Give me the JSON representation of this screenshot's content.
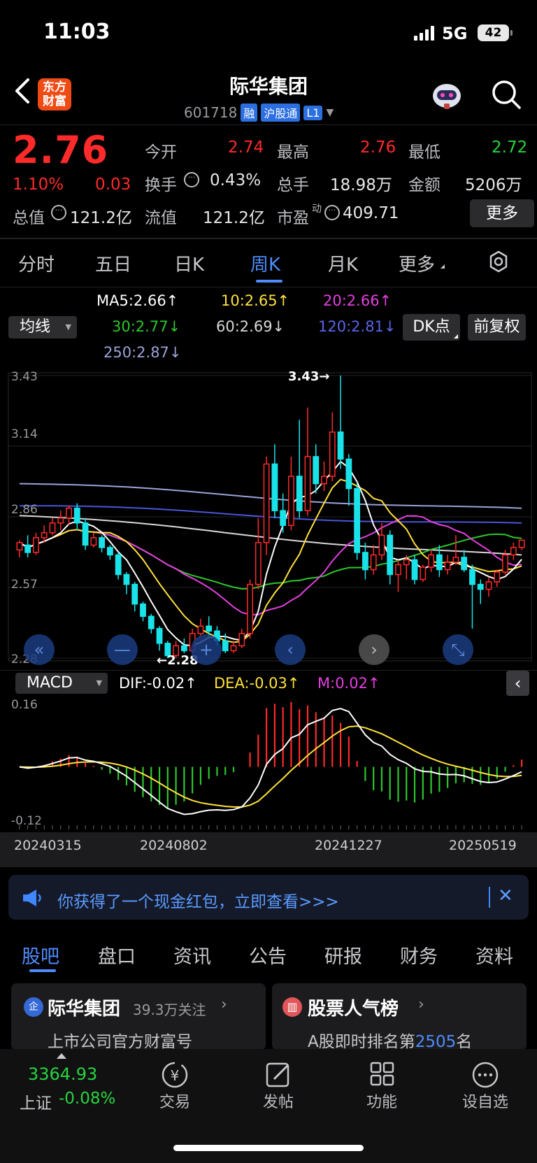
{
  "status_bar": {
    "time": "11:03",
    "network": "5G",
    "battery": "42"
  },
  "header": {
    "app_logo": "东方\n财富",
    "title": "际华集团",
    "code": "601718",
    "badges": [
      "融",
      "沪股通",
      "L1"
    ],
    "icons": [
      "back-icon",
      "robot-icon",
      "search-icon"
    ]
  },
  "quote": {
    "price": "2.76",
    "change_pct": "1.10%",
    "change": "0.03",
    "open_label": "今开",
    "open": "2.74",
    "high_label": "最高",
    "high": "2.76",
    "low_label": "最低",
    "low": "2.72",
    "turnover_label": "换手",
    "turnover": "0.43%",
    "volume_label": "总手",
    "volume": "18.98万",
    "amount_label": "金额",
    "amount": "5206万",
    "mktcap_label": "总值",
    "mktcap": "121.2亿",
    "float_label": "流值",
    "float": "121.2亿",
    "pe_label": "市盈",
    "pe_sup": "动",
    "pe": "409.71",
    "more_label": "更多"
  },
  "chart_tabs": [
    "分时",
    "五日",
    "日K",
    "周K",
    "月K",
    "更多"
  ],
  "active_tab": "周K",
  "ma_legend": {
    "ma5": "MA5:2.66↑",
    "ma10": "10:2.65↑",
    "ma20": "20:2.66↑",
    "ma30": "30:2.77↓",
    "ma60": "60:2.69↓",
    "ma120": "120:2.81↓",
    "ma250": "250:2.87↓"
  },
  "ma_button": "均线",
  "dk_button": "DK点",
  "adjust_button": "前复权",
  "colors": {
    "up": "#ff2a2a",
    "down": "#19e3e8",
    "ma5": "#ffffff",
    "ma10": "#ffe23a",
    "ma20": "#e63fe0",
    "ma30": "#2cc82c",
    "ma60": "#d8d8d8",
    "ma120": "#4955d8",
    "ma250": "#9aa3d6",
    "accent": "#4f8cff"
  },
  "chart_data": [
    {
      "type": "candlestick",
      "ylim": [
        2.28,
        3.43
      ],
      "y_ticks": [
        "3.43",
        "3.14",
        "2.86",
        "2.57",
        "2.28"
      ],
      "annotations": {
        "high": "3.43→",
        "low": "←2.28"
      },
      "candles": [
        [
          2.72,
          2.75,
          2.76,
          2.69
        ],
        [
          2.74,
          2.71,
          2.78,
          2.69
        ],
        [
          2.71,
          2.77,
          2.79,
          2.7
        ],
        [
          2.77,
          2.79,
          2.82,
          2.75
        ],
        [
          2.79,
          2.83,
          2.85,
          2.78
        ],
        [
          2.83,
          2.85,
          2.88,
          2.8
        ],
        [
          2.85,
          2.89,
          2.9,
          2.82
        ],
        [
          2.89,
          2.83,
          2.91,
          2.8
        ],
        [
          2.83,
          2.74,
          2.85,
          2.72
        ],
        [
          2.74,
          2.77,
          2.79,
          2.73
        ],
        [
          2.77,
          2.73,
          2.78,
          2.71
        ],
        [
          2.73,
          2.7,
          2.74,
          2.68
        ],
        [
          2.7,
          2.62,
          2.71,
          2.6
        ],
        [
          2.62,
          2.58,
          2.63,
          2.54
        ],
        [
          2.58,
          2.5,
          2.59,
          2.47
        ],
        [
          2.5,
          2.45,
          2.51,
          2.43
        ],
        [
          2.45,
          2.4,
          2.46,
          2.38
        ],
        [
          2.4,
          2.34,
          2.41,
          2.31
        ],
        [
          2.34,
          2.29,
          2.35,
          2.28
        ],
        [
          2.29,
          2.33,
          2.35,
          2.28
        ],
        [
          2.33,
          2.31,
          2.36,
          2.3
        ],
        [
          2.31,
          2.38,
          2.4,
          2.3
        ],
        [
          2.38,
          2.41,
          2.44,
          2.37
        ],
        [
          2.41,
          2.39,
          2.45,
          2.37
        ],
        [
          2.39,
          2.35,
          2.41,
          2.33
        ],
        [
          2.35,
          2.31,
          2.38,
          2.3
        ],
        [
          2.31,
          2.33,
          2.35,
          2.3
        ],
        [
          2.33,
          2.38,
          2.4,
          2.32
        ],
        [
          2.38,
          2.58,
          2.6,
          2.36
        ],
        [
          2.58,
          2.75,
          2.85,
          2.56
        ],
        [
          2.75,
          3.07,
          3.1,
          2.7
        ],
        [
          3.07,
          2.88,
          3.15,
          2.85
        ],
        [
          2.88,
          2.82,
          2.95,
          2.79
        ],
        [
          2.82,
          3.02,
          3.1,
          2.8
        ],
        [
          3.02,
          2.88,
          3.25,
          2.85
        ],
        [
          2.88,
          3.1,
          3.3,
          2.86
        ],
        [
          3.1,
          2.99,
          3.15,
          2.95
        ],
        [
          2.99,
          3.02,
          3.08,
          2.96
        ],
        [
          3.02,
          3.2,
          3.28,
          3.0
        ],
        [
          3.2,
          3.09,
          3.43,
          3.05
        ],
        [
          3.09,
          2.97,
          3.11,
          2.9
        ],
        [
          2.97,
          2.71,
          2.99,
          2.68
        ],
        [
          2.71,
          2.64,
          2.75,
          2.6
        ],
        [
          2.64,
          2.7,
          2.74,
          2.62
        ],
        [
          2.7,
          2.78,
          2.83,
          2.68
        ],
        [
          2.78,
          2.62,
          2.8,
          2.58
        ],
        [
          2.62,
          2.66,
          2.68,
          2.55
        ],
        [
          2.66,
          2.68,
          2.7,
          2.6
        ],
        [
          2.68,
          2.6,
          2.7,
          2.58
        ],
        [
          2.6,
          2.65,
          2.66,
          2.59
        ],
        [
          2.65,
          2.7,
          2.72,
          2.63
        ],
        [
          2.7,
          2.64,
          2.74,
          2.61
        ],
        [
          2.64,
          2.67,
          2.7,
          2.62
        ],
        [
          2.67,
          2.69,
          2.78,
          2.66
        ],
        [
          2.69,
          2.64,
          2.72,
          2.63
        ],
        [
          2.64,
          2.58,
          2.66,
          2.4
        ],
        [
          2.58,
          2.56,
          2.6,
          2.5
        ],
        [
          2.56,
          2.59,
          2.61,
          2.53
        ],
        [
          2.59,
          2.63,
          2.64,
          2.57
        ],
        [
          2.63,
          2.7,
          2.72,
          2.62
        ],
        [
          2.7,
          2.73,
          2.75,
          2.68
        ],
        [
          2.73,
          2.76,
          2.76,
          2.72
        ]
      ]
    },
    {
      "type": "bar",
      "title": "MACD",
      "legend": {
        "dif": "DIF:-0.02↑",
        "dea": "DEA:-0.03↑",
        "m": "M:0.02↑"
      },
      "ylim": [
        -0.12,
        0.16
      ],
      "y_ticks": [
        "0.16",
        "-0.12"
      ],
      "x_ticks": [
        "20240315",
        "20240802",
        "20241227",
        "20250519"
      ]
    }
  ],
  "nav_buttons": [
    "double-left-icon",
    "zoom-out-icon",
    "zoom-in-icon",
    "prev-icon",
    "next-icon",
    "fullscreen-icon"
  ],
  "banner": {
    "text": "你获得了一个现金红包，立即查看>>>"
  },
  "bottom_tabs": [
    "股吧",
    "盘口",
    "资讯",
    "公告",
    "研报",
    "财务",
    "资料"
  ],
  "active_bottom_tab": "股吧",
  "card1": {
    "name": "际华集团",
    "followers": "39.3万关注",
    "sub": "上市公司官方财富号"
  },
  "card2": {
    "name": "股票人气榜",
    "sub_prefix": "A股即时排名第",
    "rank": "2505",
    "sub_suffix": "名"
  },
  "index": {
    "value": "3364.93",
    "name": "上证",
    "change": "-0.08%"
  },
  "bottom_nav": [
    {
      "label": "交易",
      "icon": "yen-icon"
    },
    {
      "label": "发帖",
      "icon": "edit-icon"
    },
    {
      "label": "功能",
      "icon": "apps-icon"
    },
    {
      "label": "设自选",
      "icon": "more-icon"
    }
  ]
}
